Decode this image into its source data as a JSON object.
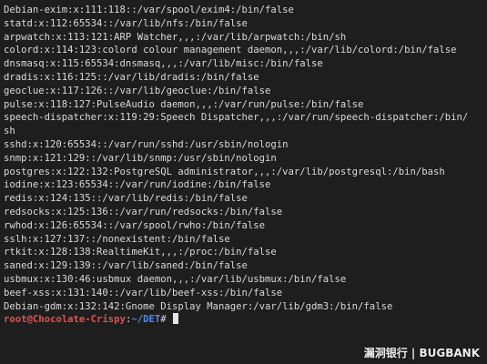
{
  "terminal": {
    "lines": [
      "Debian-exim:x:111:118::/var/spool/exim4:/bin/false",
      "statd:x:112:65534::/var/lib/nfs:/bin/false",
      "arpwatch:x:113:121:ARP Watcher,,,:/var/lib/arpwatch:/bin/sh",
      "colord:x:114:123:colord colour management daemon,,,:/var/lib/colord:/bin/false",
      "dnsmasq:x:115:65534:dnsmasq,,,:/var/lib/misc:/bin/false",
      "dradis:x:116:125::/var/lib/dradis:/bin/false",
      "geoclue:x:117:126::/var/lib/geoclue:/bin/false",
      "pulse:x:118:127:PulseAudio daemon,,,:/var/run/pulse:/bin/false",
      "speech-dispatcher:x:119:29:Speech Dispatcher,,,:/var/run/speech-dispatcher:/bin/",
      "sh",
      "sshd:x:120:65534::/var/run/sshd:/usr/sbin/nologin",
      "snmp:x:121:129::/var/lib/snmp:/usr/sbin/nologin",
      "postgres:x:122:132:PostgreSQL administrator,,,:/var/lib/postgresql:/bin/bash",
      "iodine:x:123:65534::/var/run/iodine:/bin/false",
      "redis:x:124:135::/var/lib/redis:/bin/false",
      "redsocks:x:125:136::/var/run/redsocks:/bin/false",
      "rwhod:x:126:65534::/var/spool/rwho:/bin/false",
      "sslh:x:127:137::/nonexistent:/bin/false",
      "rtkit:x:128:138:RealtimeKit,,,:/proc:/bin/false",
      "saned:x:129:139::/var/lib/saned:/bin/false",
      "usbmux:x:130:46:usbmux daemon,,,:/var/lib/usbmux:/bin/false",
      "beef-xss:x:131:140::/var/lib/beef-xss:/bin/false",
      "Debian-gdm:x:132:142:Gnome Display Manager:/var/lib/gdm3:/bin/false"
    ],
    "prompt": {
      "user_host": "root@Chocolate-Crispy",
      "separator": ":",
      "path": "~/DET",
      "symbol": "#"
    },
    "colors": {
      "background": "#1e1e1e",
      "text": "#d9d9d9",
      "user_host": "#e05252",
      "path": "#4b8df2"
    }
  },
  "watermark": {
    "text": "漏洞银行 | BUGBANK"
  }
}
